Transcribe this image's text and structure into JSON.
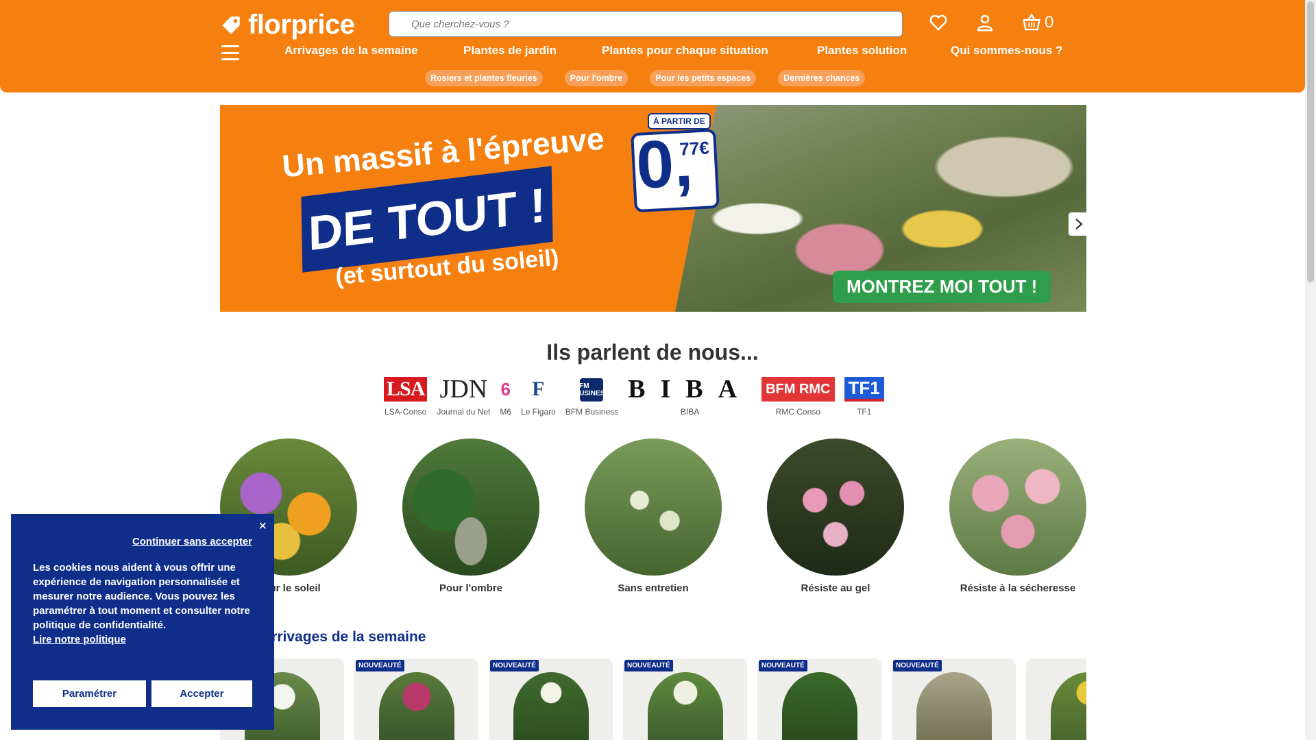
{
  "header": {
    "logo_text": "florprice",
    "search_placeholder": "Que cherchez-vous ?",
    "cart_count": "0",
    "nav": [
      "Arrivages de la semaine",
      "Plantes de jardin",
      "Plantes pour chaque situation",
      "Plantes solution",
      "Qui sommes-nous ?"
    ],
    "chips": [
      "Rosiers et plantes fleuries",
      "Pour l'ombre",
      "Pour les petits espaces",
      "Dernières chances"
    ],
    "colors": {
      "brand_orange": "#f5800f",
      "brand_blue": "#0f2e8a"
    }
  },
  "banner": {
    "line1": "Un massif à l'épreuve",
    "line2": "DE TOUT !",
    "line3": "(et surtout du soleil)",
    "price_prefix": "À PARTIR DE",
    "price_main": "0,",
    "price_cents": "77€",
    "cta": "MONTREZ MOI TOUT !"
  },
  "press": {
    "title": "Ils parlent de nous...",
    "items": [
      {
        "logo": "LSA",
        "name": "LSA-Conso"
      },
      {
        "logo": "JDN",
        "name": "Journal du Net"
      },
      {
        "logo": "6",
        "name": "M6"
      },
      {
        "logo": "F",
        "name": "Le Figaro"
      },
      {
        "logo": "BFM BUSINESS",
        "name": "BFM Business"
      },
      {
        "logo": "BIBA",
        "name": "BIBA"
      },
      {
        "logo": "BFM RMC",
        "name": "RMC Conso"
      },
      {
        "logo": "TF1",
        "name": "TF1"
      }
    ]
  },
  "categories": [
    "Pour le soleil",
    "Pour l'ombre",
    "Sans entretien",
    "Résiste au gel",
    "Résiste à la sécheresse"
  ],
  "arrivals": {
    "title": "Arrivages de la semaine",
    "badge": "NOUVEAUTÉ"
  },
  "cookie": {
    "continue": "Continuer sans accepter",
    "text": "Les cookies nous aident à vous offrir une expérience de navigation personnalisée et mesurer notre audience. Vous pouvez les paramétrer à tout moment et consulter notre politique de confidentialité.",
    "link": "Lire notre politique",
    "settings_button": "Paramétrer",
    "accept_button": "Accepter"
  }
}
